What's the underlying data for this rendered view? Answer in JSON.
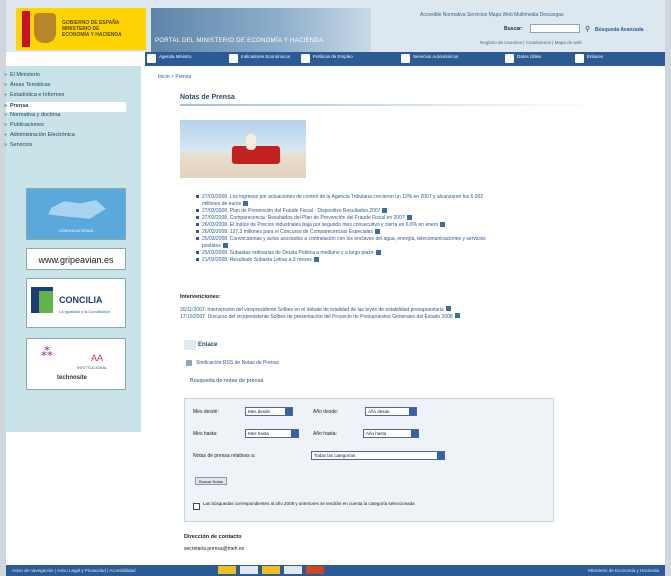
{
  "header": {
    "logo_text": "GOBIERNO DE ESPAÑA MINISTERIO DE ECONOMÍA Y HACIENDA",
    "banner_text": "PORTAL DEL MINISTERIO DE ECONOMÍA Y HACIENDA",
    "top_links": "Accesible  Normativa  Servicios  Mapa Web  Multimedia  Descargas",
    "search_label": "Buscar:",
    "search_value": "",
    "advanced_search": "Búsqueda Avanzada",
    "secondary_links": "Registro de Usuarios  |  Contáctenos  |  Mapa de web"
  },
  "nav": {
    "items": [
      {
        "label": "Agenda Ministro",
        "icon": "agenda-icon"
      },
      {
        "label": "Indicadores Económicos",
        "icon": "chart-icon"
      },
      {
        "label": "Políticas de Empleo",
        "icon": "flag-icon"
      },
      {
        "label": "Servicios Autonómicos",
        "icon": "building-icon"
      },
      {
        "label": "Datos Útiles",
        "icon": "info-icon"
      },
      {
        "label": "Enlaces",
        "icon": "link-icon"
      }
    ]
  },
  "sidebar": {
    "items": [
      {
        "label": "El Ministerio"
      },
      {
        "label": "Áreas Temáticas"
      },
      {
        "label": "Estadística e Informes"
      },
      {
        "label": "Normativa y doctrina"
      },
      {
        "label": "Publicaciones"
      },
      {
        "label": "Administración Electrónica"
      },
      {
        "label": "Servicios"
      },
      {
        "label": "Prensa"
      }
    ],
    "active_index": 7,
    "ads": {
      "ad1_label": "CONVOCATORIAS",
      "ad2_label": "www.gripeavian.es",
      "ad3_label": "CONCILIA",
      "ad3_sub": "La Igualdad y la Conciliación",
      "ad4_label": "AA",
      "ad4_sub": "INSTITUCIONAL",
      "ad4_title": "technosite"
    }
  },
  "main": {
    "breadcrumb": "Inicio > Prensa",
    "title": "Notas de Prensa",
    "news": [
      "27/03/2008. Los ingresos por actuaciones de control de la Agencia Tributaria crecieron un 13% en 2007 y alcanzaron los 6.002",
      "millones de euros",
      "27/03/2008. Plan de Prevención del Fraude Fiscal - Dispositivo Resultados 2007",
      "27/03/2008. Comparecencia: Resultados del Plan de Prevención del Fraude Fiscal en 2007",
      "26/03/2008. El índice de Precios Industriales baja por segundo mes consecutivo y cierra en 6,6% en enero",
      "26/03/2008. 127,3 millones para el Concurso de Comparecencias Especiales",
      "25/03/2008. Convocatorias y actos asociados a contratación con los enclaves del agua, energía, telecomunicaciones y servicios",
      "postales",
      "25/03/2008. Subastas ordinarias de Deuda Pública a mediano y a largo plazo",
      "21/03/2008. Resultado Subasta Letras a 3 meses"
    ],
    "interventions_title": "Intervenciones:",
    "interventions": [
      "20/11/2007. Intervención del vicepresidente Solbes en el debate de totalidad de las leyes de estabilidad presupuestaria",
      "17/10/2007. Discurso del vicepresidente Solbes de presentación del Proyecto de Presupuestos Generales del Estado 2008"
    ],
    "link_title": "Enlace",
    "syndication": "Sindicación RSS de Notas de Prensa",
    "search_title": "Búsqueda de notas de prensa",
    "form": {
      "month_from_label": "Mes desde:",
      "month_from_value": "Mes desde",
      "year_from_label": "Año desde:",
      "year_from_value": "Año desde",
      "month_to_label": "Mes hasta:",
      "month_to_value": "Mes hasta",
      "year_to_label": "Año hasta:",
      "year_to_value": "Año hasta",
      "category_label": "Notas de prensa relativas a:",
      "category_value": "Todas las categorías",
      "button_label": "Buscar Notas",
      "checkbox_label": "Las búsquedas correspondientes al año 2008 y anteriores se tendrán en cuenta la categoría seleccionada"
    },
    "contact_title": "Dirección de contacto",
    "contact_email": "secretaria.prensa@meh.es"
  },
  "footer": {
    "left_links": "Aviso de navegación  |  Aviso Legal y Privacidad  |  Accesibilidad",
    "right_text": "Ministerio de Economía y Hacienda"
  }
}
